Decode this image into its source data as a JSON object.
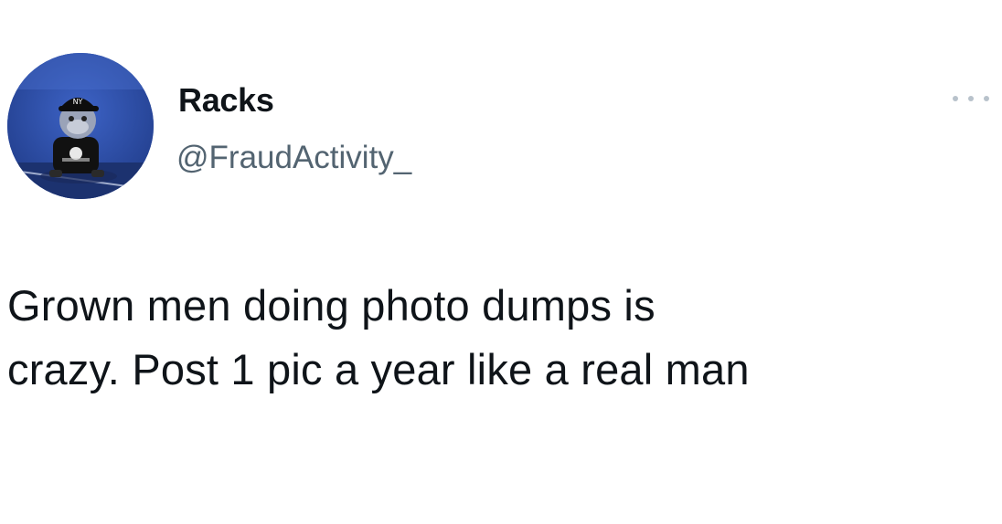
{
  "tweet": {
    "author": {
      "display_name": "Racks",
      "handle": "@FraudActivity_",
      "avatar_icon": "profile-avatar"
    },
    "more_icon": "more-options-icon",
    "text_lines": [
      "Grown men doing photo dumps is",
      "crazy. Post 1 pic a year like a real man"
    ]
  },
  "colors": {
    "text_primary": "#0f1419",
    "text_secondary": "#536471",
    "background": "#ffffff",
    "avatar_bg": "#2d4ea8"
  }
}
